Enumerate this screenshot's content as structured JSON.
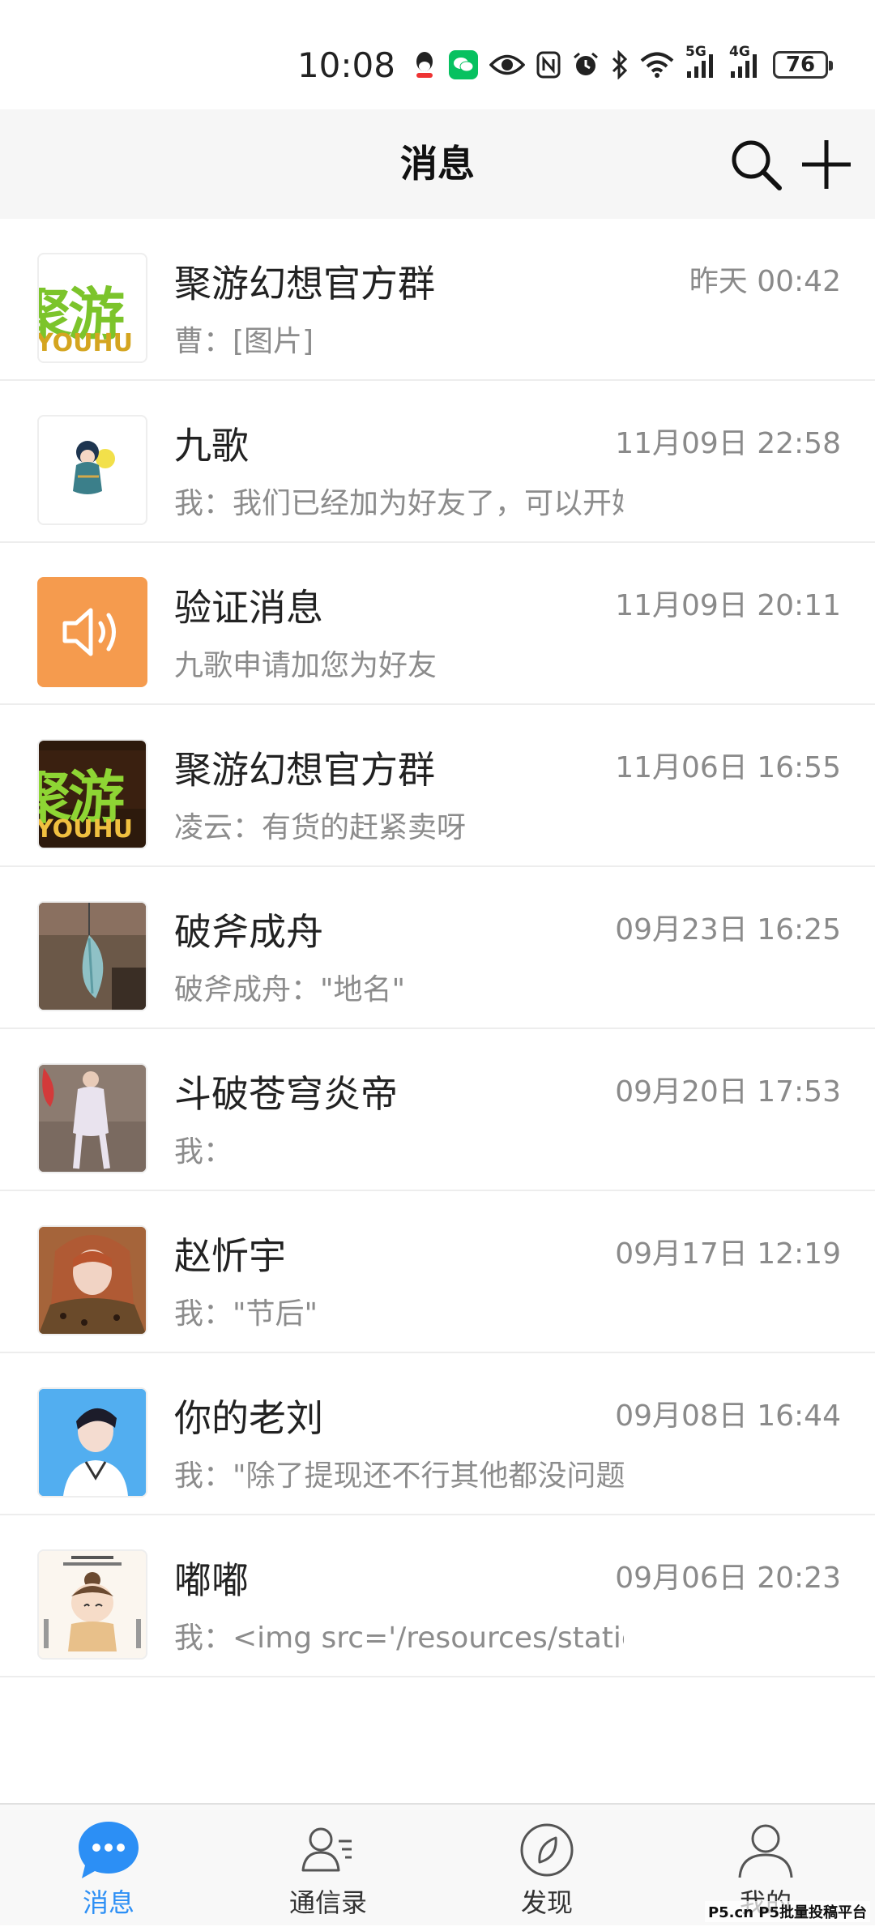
{
  "status_bar": {
    "time": "10:08",
    "network1": "5G",
    "network2": "4G",
    "battery": "76"
  },
  "header": {
    "title": "消息"
  },
  "messages": [
    {
      "name": "聚游幻想官方群",
      "time": "昨天 00:42",
      "preview": "曹：[图片]",
      "avatar_text": "聚游",
      "avatar_sub": "YOUHU"
    },
    {
      "name": "九歌",
      "time": "11月09日 22:58",
      "preview": "我：我们已经加为好友了，可以开始"
    },
    {
      "name": "验证消息",
      "time": "11月09日 20:11",
      "preview": "九歌申请加您为好友"
    },
    {
      "name": "聚游幻想官方群",
      "time": "11月06日 16:55",
      "preview": "凌云：有货的赶紧卖呀",
      "avatar_text": "聚游",
      "avatar_sub": "YOUHU"
    },
    {
      "name": "破斧成舟",
      "time": "09月23日 16:25",
      "preview": "破斧成舟：\"地名\""
    },
    {
      "name": "斗破苍穹炎帝",
      "time": "09月20日 17:53",
      "preview": "我："
    },
    {
      "name": "赵忻宇",
      "time": "09月17日 12:19",
      "preview": "我：\"节后\""
    },
    {
      "name": "你的老刘",
      "time": "09月08日 16:44",
      "preview": "我：\"除了提现还不行其他都没问题\""
    },
    {
      "name": "嘟嘟",
      "time": "09月06日 20:23",
      "preview": "我：<img src='/resources/static/em"
    }
  ],
  "nav": {
    "messages": "消息",
    "contacts": "通信录",
    "discover": "发现",
    "me": "我的"
  },
  "colors": {
    "accent": "#2c8ff5",
    "header_bg": "#f6f6f6",
    "youhu_green": "#7cc42b",
    "notice_orange": "#f59b4e"
  },
  "watermark": "P5.cn P5批量投稿平台"
}
